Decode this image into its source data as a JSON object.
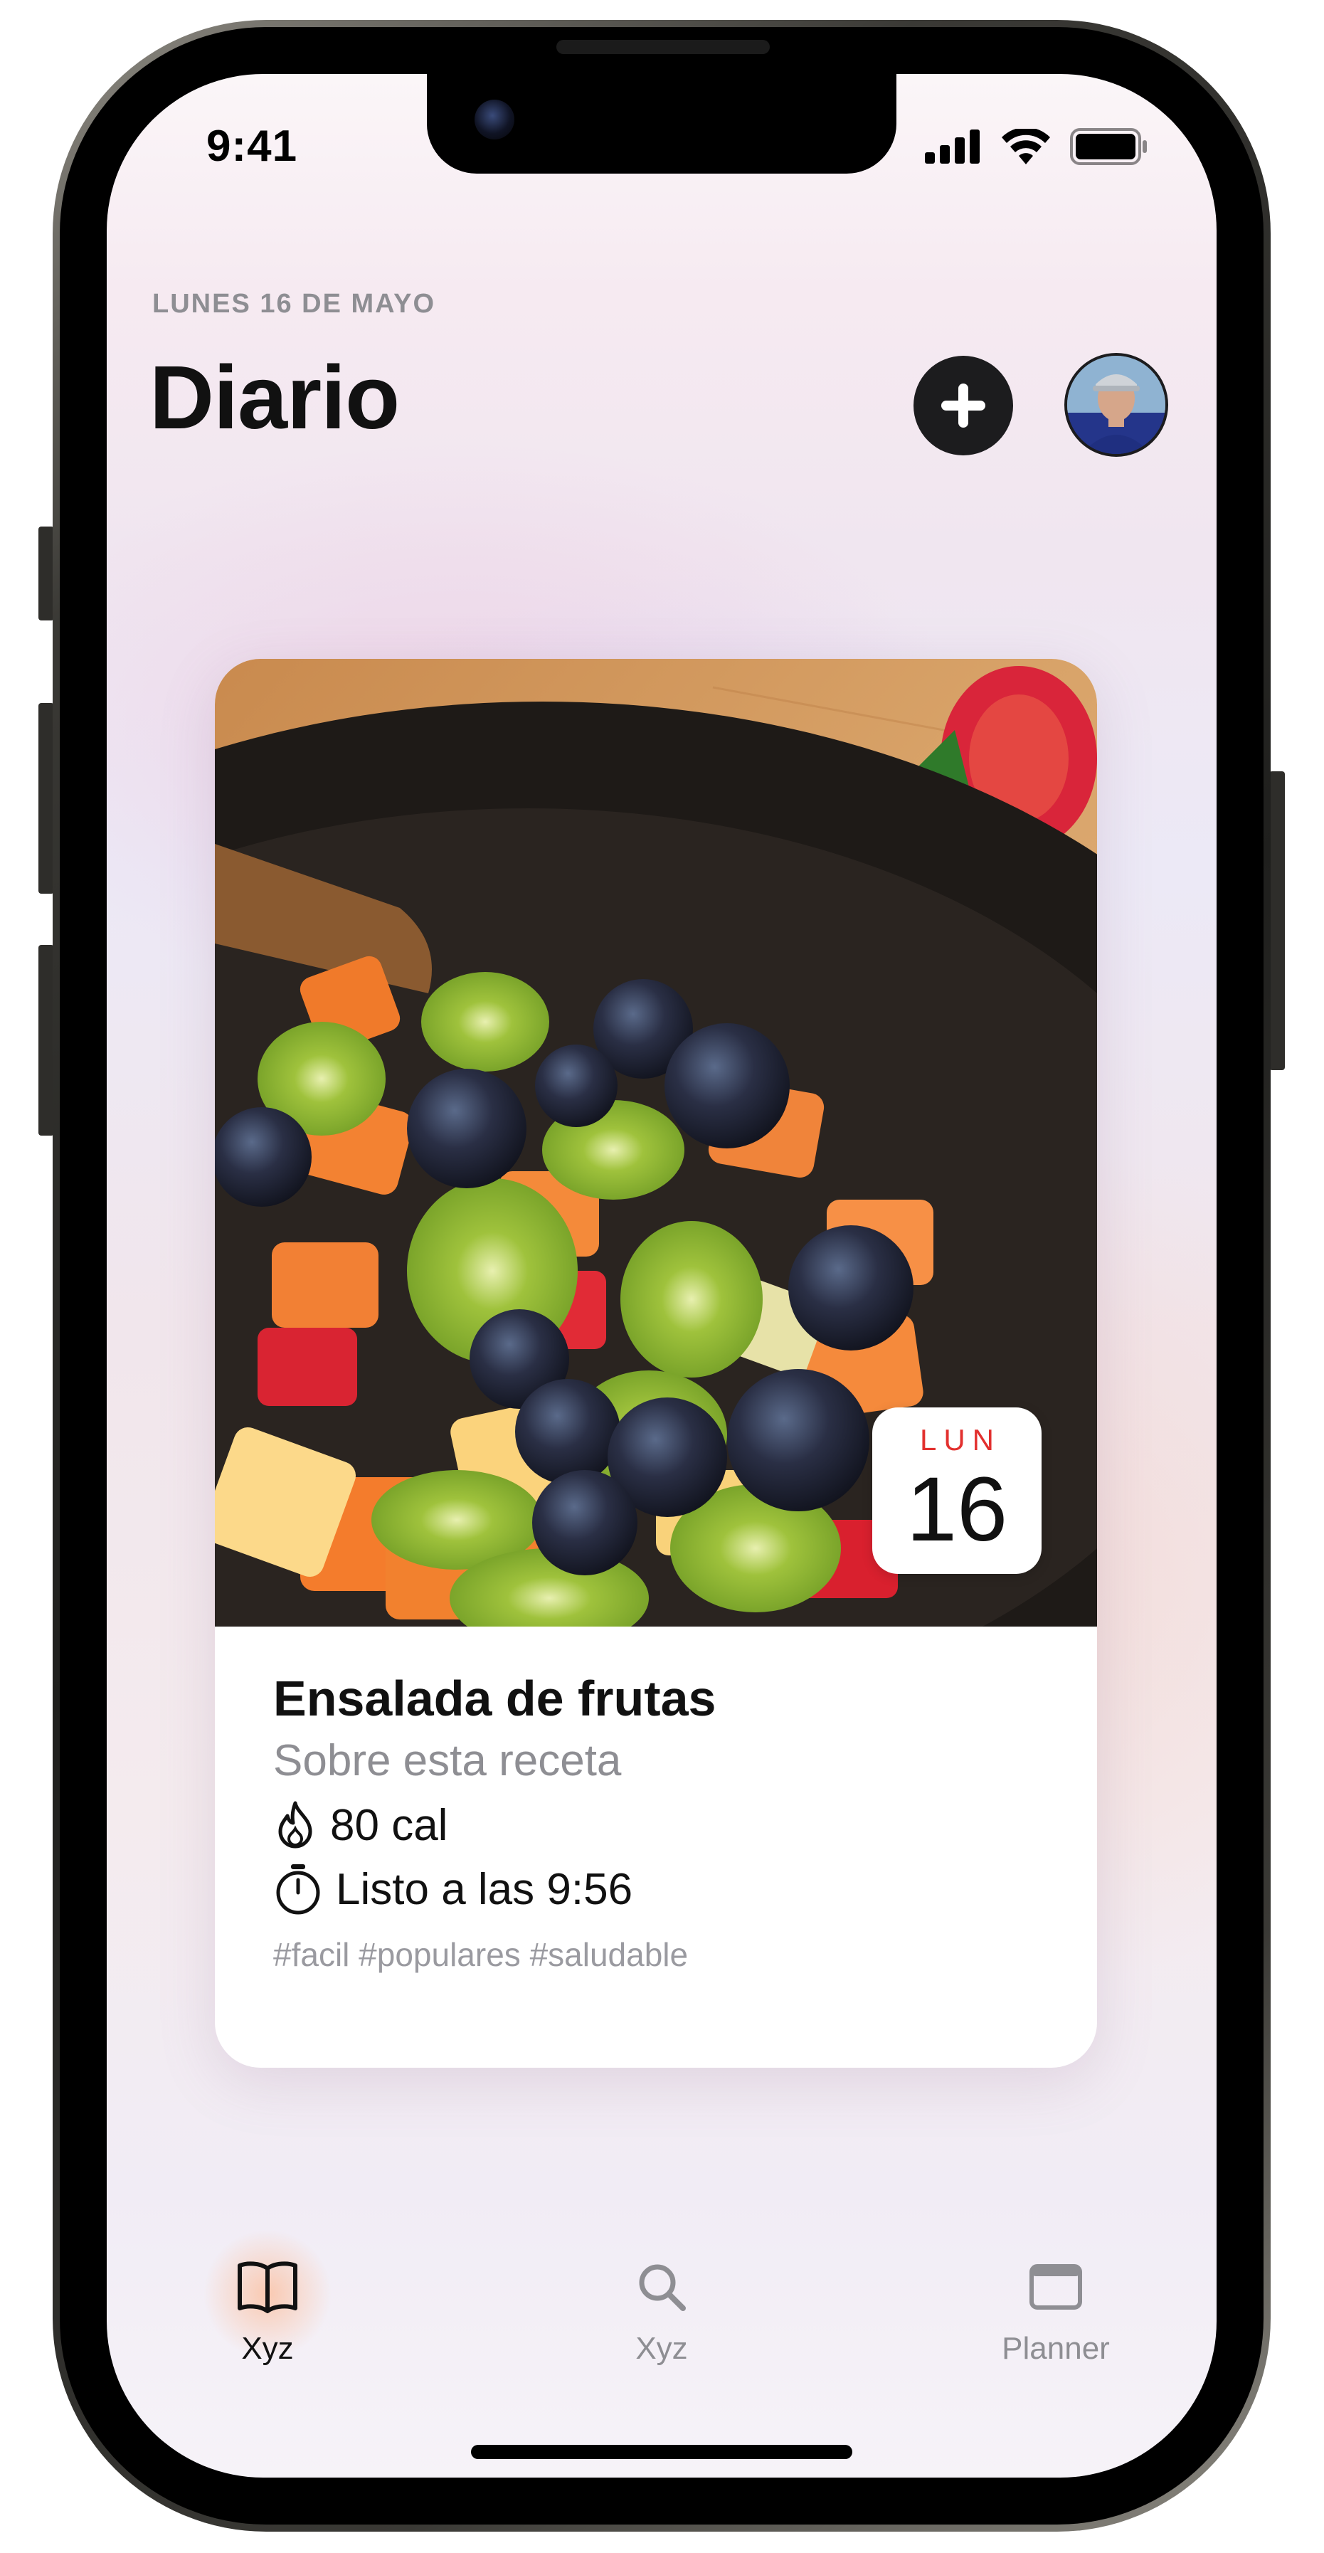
{
  "status_bar": {
    "time": "9:41"
  },
  "header": {
    "date": "LUNES 16 DE MAYO",
    "title": "Diario",
    "add_icon": "plus-icon",
    "avatar_icon": "user-avatar"
  },
  "card": {
    "image": "fruit-salad-photo",
    "badge": {
      "day": "LUN",
      "number": "16"
    },
    "title": "Ensalada de frutas",
    "subtitle": "Sobre esta receta",
    "calories": {
      "icon": "flame-icon",
      "text": "80 cal"
    },
    "ready": {
      "icon": "timer-icon",
      "text": "Listo a las 9:56"
    },
    "tags": "#facil #populares #saludable"
  },
  "tabbar": {
    "tabs": [
      {
        "icon": "book-icon",
        "label": "Xyz",
        "active": true
      },
      {
        "icon": "search-icon",
        "label": "Xyz",
        "active": false
      },
      {
        "icon": "window-icon",
        "label": "Planner",
        "active": false
      }
    ]
  },
  "colors": {
    "accent": "#1c1c1e",
    "secondary_text": "#8e8e93",
    "badge_red": "#e2302e"
  }
}
